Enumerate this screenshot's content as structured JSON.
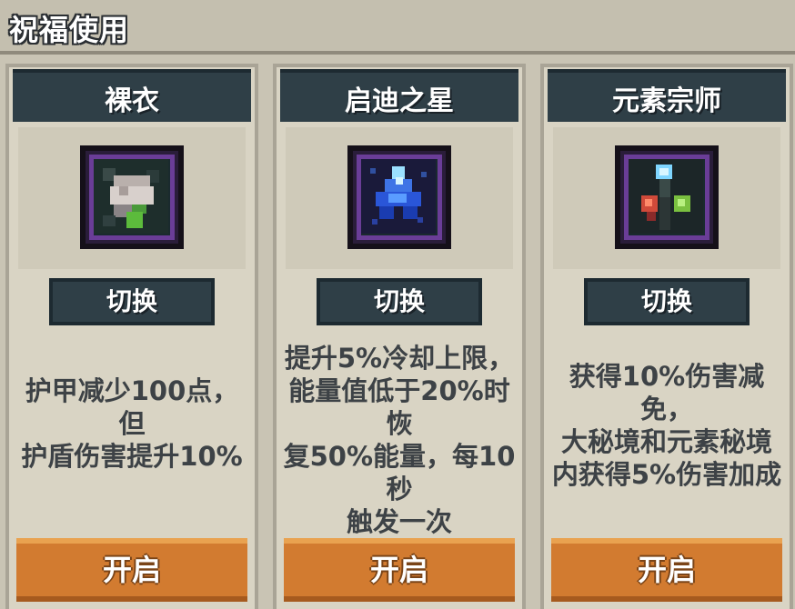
{
  "header": {
    "title": "祝福使用"
  },
  "cards": [
    {
      "title": "裸衣",
      "icon": "naked-robe-icon",
      "switch_label": "切换",
      "description": [
        "护甲减少100点，但",
        "护盾伤害提升10%"
      ],
      "open_label": "开启"
    },
    {
      "title": "启迪之星",
      "icon": "blue-star-crystal-icon",
      "switch_label": "切换",
      "description": [
        "提升5%冷却上限，",
        "能量值低于20%时恢",
        "复50%能量，每10秒",
        "触发一次"
      ],
      "open_label": "开启"
    },
    {
      "title": "元素宗师",
      "icon": "elemental-staff-icon",
      "switch_label": "切换",
      "description": [
        "获得10%伤害减免，",
        "大秘境和元素秘境",
        "内获得5%伤害加成"
      ],
      "open_label": "开启"
    }
  ],
  "colors": {
    "title_bar": "#2f3f47",
    "button_orange": "#d27b30",
    "icon_border": "#6a3d97"
  }
}
